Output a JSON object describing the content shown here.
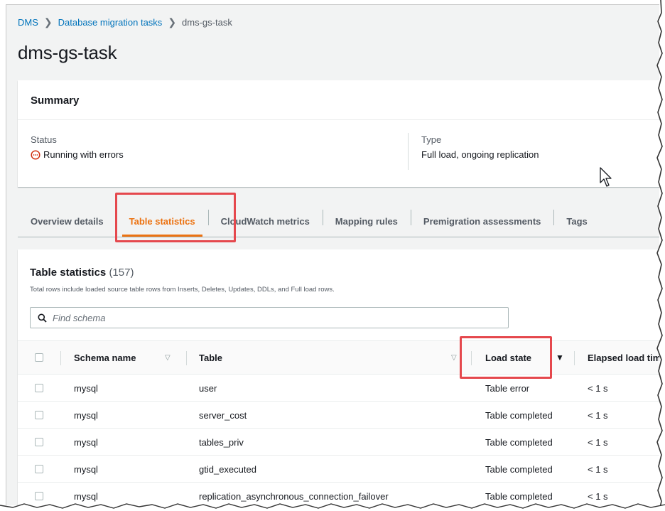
{
  "breadcrumb": {
    "dms": "DMS",
    "tasks": "Database migration tasks",
    "current": "dms-gs-task"
  },
  "page_title": "dms-gs-task",
  "summary": {
    "title": "Summary",
    "status_label": "Status",
    "status_value": "Running with errors",
    "type_label": "Type",
    "type_value": "Full load, ongoing replication"
  },
  "tabs": [
    {
      "label": "Overview details",
      "active": false
    },
    {
      "label": "Table statistics",
      "active": true
    },
    {
      "label": "CloudWatch metrics",
      "active": false
    },
    {
      "label": "Mapping rules",
      "active": false
    },
    {
      "label": "Premigration assessments",
      "active": false
    },
    {
      "label": "Tags",
      "active": false
    }
  ],
  "table_stats": {
    "title": "Table statistics",
    "count": "(157)",
    "description": "Total rows include loaded source table rows from Inserts, Deletes, Updates, DDLs, and Full load rows.",
    "search_placeholder": "Find schema",
    "columns": [
      "Schema name",
      "Table",
      "Load state",
      "Elapsed load time"
    ],
    "rows": [
      {
        "schema": "mysql",
        "table": "user",
        "load_state": "Table error",
        "elapsed": "< 1 s"
      },
      {
        "schema": "mysql",
        "table": "server_cost",
        "load_state": "Table completed",
        "elapsed": "< 1 s"
      },
      {
        "schema": "mysql",
        "table": "tables_priv",
        "load_state": "Table completed",
        "elapsed": "< 1 s"
      },
      {
        "schema": "mysql",
        "table": "gtid_executed",
        "load_state": "Table completed",
        "elapsed": "< 1 s"
      },
      {
        "schema": "mysql",
        "table": "replication_asynchronous_connection_failover",
        "load_state": "Table completed",
        "elapsed": "< 1 s"
      }
    ]
  },
  "colors": {
    "link": "#0073bb",
    "error": "#d13212",
    "active_tab": "#ec7211",
    "highlight": "#e5484d"
  },
  "icons": {
    "status": "error-circle-icon",
    "search": "search-icon",
    "sort": "sort-triangle-icon",
    "cursor": "mouse-pointer-icon"
  }
}
